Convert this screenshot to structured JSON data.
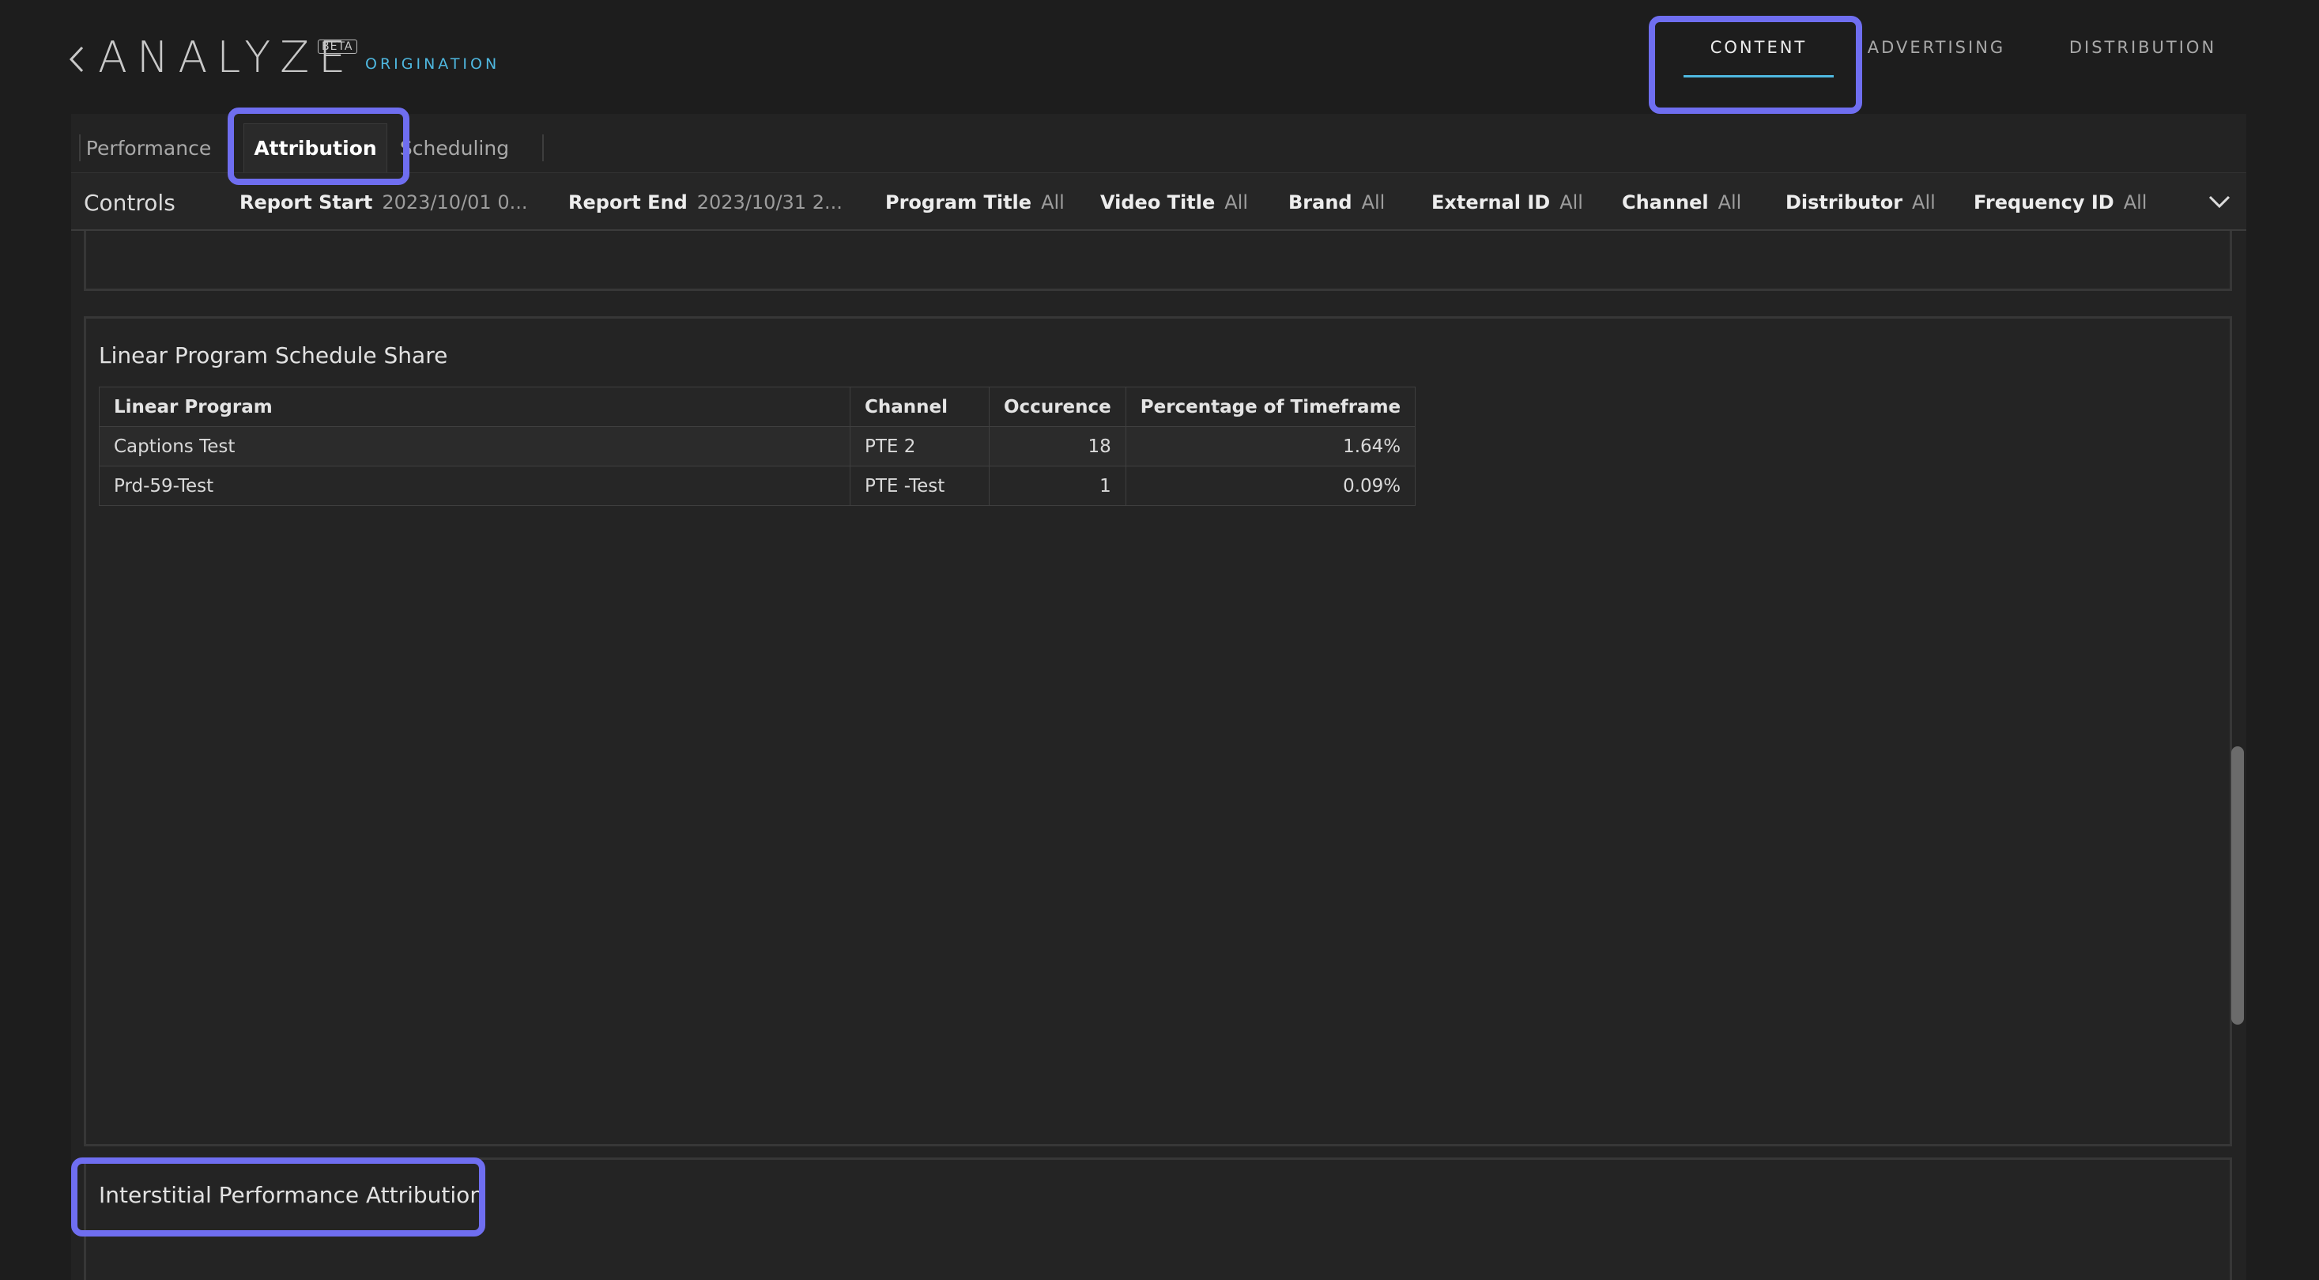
{
  "header": {
    "brand": "ANALYZE",
    "beta_badge": "BETA",
    "subtitle": "ORIGINATION",
    "nav": [
      {
        "label": "CONTENT",
        "active": true
      },
      {
        "label": "ADVERTISING",
        "active": false
      },
      {
        "label": "DISTRIBUTION",
        "active": false
      }
    ]
  },
  "subtabs": [
    {
      "label": "Performance",
      "active": false
    },
    {
      "label": "Attribution",
      "active": true
    },
    {
      "label": "Scheduling",
      "active": false
    }
  ],
  "controls": {
    "label": "Controls",
    "filters": [
      {
        "key": "Report Start",
        "value": "2023/10/01 0..."
      },
      {
        "key": "Report End",
        "value": "2023/10/31 2..."
      },
      {
        "key": "Program Title",
        "value": "All"
      },
      {
        "key": "Video Title",
        "value": "All"
      },
      {
        "key": "Brand",
        "value": "All"
      },
      {
        "key": "External ID",
        "value": "All"
      },
      {
        "key": "Channel",
        "value": "All"
      },
      {
        "key": "Distributor",
        "value": "All"
      },
      {
        "key": "Frequency ID",
        "value": "All"
      }
    ]
  },
  "schedule_share": {
    "title": "Linear Program Schedule Share",
    "columns": [
      "Linear Program",
      "Channel",
      "Occurence",
      "Percentage of Timeframe"
    ],
    "rows": [
      [
        "Captions Test",
        "PTE 2",
        "18",
        "1.64%"
      ],
      [
        "Prd-59-Test",
        "PTE -Test",
        "1",
        "0.09%"
      ]
    ]
  },
  "interstitial": {
    "title": "Interstitial Performance Attribution"
  },
  "colors": {
    "background": "#1d1d1d",
    "panel": "#232323",
    "accent": "#4fb8e0",
    "highlight": "#6f6ef0"
  }
}
